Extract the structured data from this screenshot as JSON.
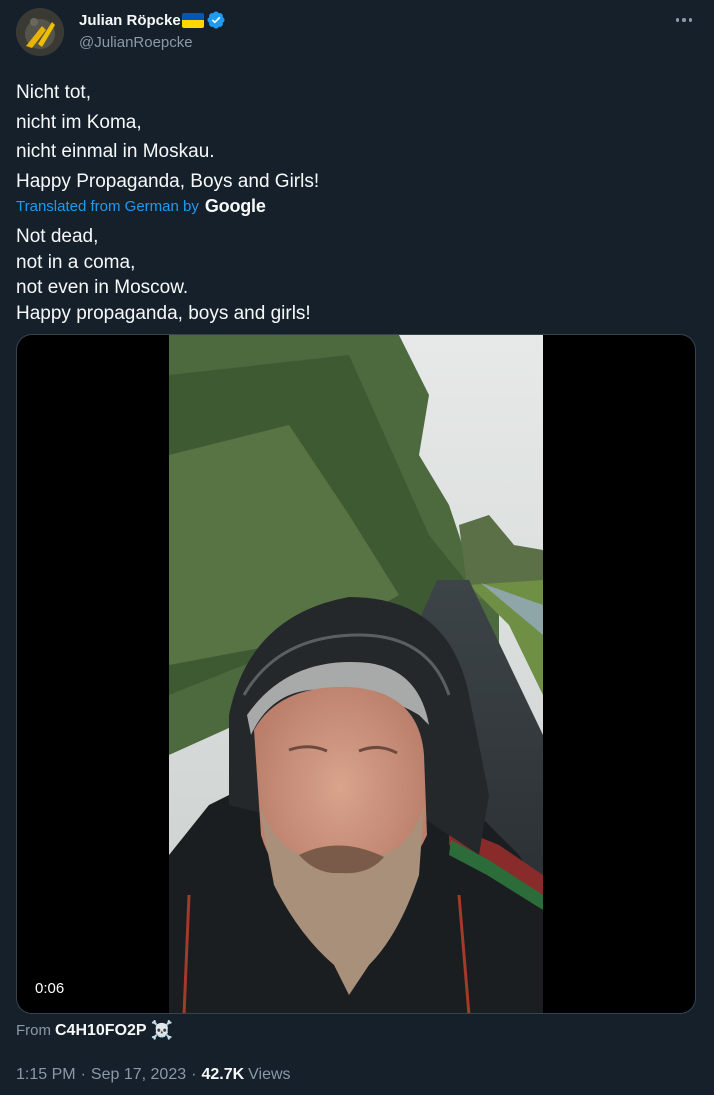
{
  "author": {
    "display_name": "Julian Röpcke",
    "handle": "@JulianRoepcke",
    "flag_icon": "ukraine-flag-icon",
    "verified_icon": "verified-badge-icon",
    "verified_color": "#1d9bf0"
  },
  "more_icon": "more-options-icon",
  "tweet": {
    "original_lines": [
      "Nicht tot,",
      "nicht im Koma,",
      "nicht einmal in Moskau.",
      "Happy Propaganda, Boys and Girls!"
    ],
    "translated_label": "Translated from German by",
    "translator_brand": "Google",
    "translation_lines": [
      "Not dead,",
      "not in a coma,",
      "not even in Moscow.",
      "Happy propaganda, boys and girls!"
    ]
  },
  "video": {
    "duration": "0:06"
  },
  "source": {
    "label": "From",
    "account": "C4H10FO2P",
    "emoji": "☠️"
  },
  "meta": {
    "time": "1:15 PM",
    "date": "Sep 17, 2023",
    "separator": "·",
    "views_count": "42.7K",
    "views_label": "Views"
  },
  "colors": {
    "background": "#15202b",
    "text_primary": "#f7f9f9",
    "text_secondary": "#8b98a5",
    "accent": "#1d9bf0"
  }
}
